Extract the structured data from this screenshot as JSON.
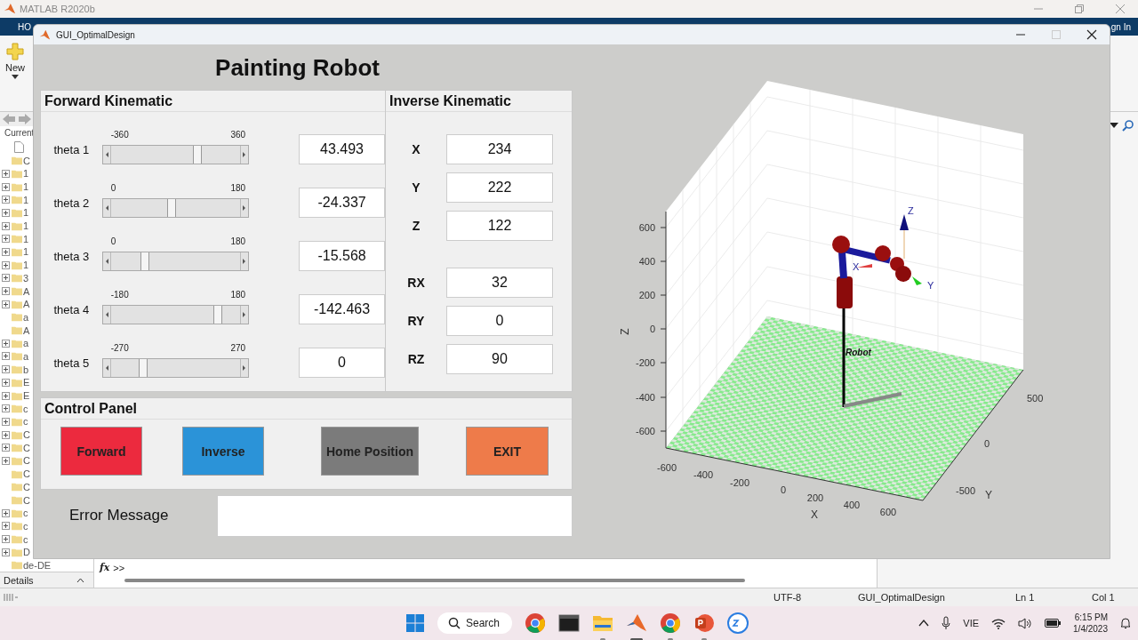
{
  "desktop_window": {
    "title": "MATLAB R2020b",
    "toolstrip_tab": "HO",
    "sign_in": "gn In",
    "new_button": "New",
    "current_folder_label": "Current",
    "folders": [
      {
        "name": "C",
        "expandable": false
      },
      {
        "name": "1",
        "expandable": true
      },
      {
        "name": "1",
        "expandable": true
      },
      {
        "name": "1",
        "expandable": true
      },
      {
        "name": "1",
        "expandable": true
      },
      {
        "name": "1",
        "expandable": true
      },
      {
        "name": "1",
        "expandable": true
      },
      {
        "name": "1",
        "expandable": true
      },
      {
        "name": "1",
        "expandable": true
      },
      {
        "name": "3",
        "expandable": true
      },
      {
        "name": "A",
        "expandable": true
      },
      {
        "name": "A",
        "expandable": true
      },
      {
        "name": "a",
        "expandable": false
      },
      {
        "name": "A",
        "expandable": false
      },
      {
        "name": "a",
        "expandable": true
      },
      {
        "name": "a",
        "expandable": true
      },
      {
        "name": "b",
        "expandable": true
      },
      {
        "name": "E",
        "expandable": true
      },
      {
        "name": "E",
        "expandable": true
      },
      {
        "name": "c",
        "expandable": true
      },
      {
        "name": "c",
        "expandable": true
      },
      {
        "name": "C",
        "expandable": true
      },
      {
        "name": "C",
        "expandable": true
      },
      {
        "name": "C",
        "expandable": true
      },
      {
        "name": "C",
        "expandable": false
      },
      {
        "name": "C",
        "expandable": false
      },
      {
        "name": "C",
        "expandable": false
      },
      {
        "name": "c",
        "expandable": true
      },
      {
        "name": "c",
        "expandable": true
      },
      {
        "name": "c",
        "expandable": true
      },
      {
        "name": "D",
        "expandable": true
      },
      {
        "name": "de-DE",
        "expandable": false
      }
    ],
    "command_fx": "fx",
    "command_prompt": ">>",
    "details_label": "Details",
    "status": {
      "encoding": "UTF-8",
      "file": "GUI_OptimalDesign",
      "line": "Ln  1",
      "column": "Col  1"
    }
  },
  "gui_window": {
    "title": "GUI_OptimalDesign",
    "heading": "Painting Robot",
    "forward_kinematic": {
      "title": "Forward Kinematic",
      "joints": [
        {
          "label": "theta 1",
          "min": "-360",
          "max": "360",
          "level": 0.66,
          "value": "43.493"
        },
        {
          "label": "theta 2",
          "min": "0",
          "max": "180",
          "level": 0.46,
          "value": "-24.337"
        },
        {
          "label": "theta 3",
          "min": "0",
          "max": "180",
          "level": 0.26,
          "value": "-15.568"
        },
        {
          "label": "theta 4",
          "min": "-180",
          "max": "180",
          "level": 0.82,
          "value": "-142.463"
        },
        {
          "label": "theta 5",
          "min": "-270",
          "max": "270",
          "level": 0.24,
          "value": "0"
        }
      ]
    },
    "inverse_kinematic": {
      "title": "Inverse Kinematic",
      "fields": [
        {
          "label": "X",
          "value": "234"
        },
        {
          "label": "Y",
          "value": "222"
        },
        {
          "label": "Z",
          "value": "122"
        },
        {
          "label": "RX",
          "value": "32"
        },
        {
          "label": "RY",
          "value": "0"
        },
        {
          "label": "RZ",
          "value": "90"
        }
      ]
    },
    "control_panel": {
      "title": "Control Panel",
      "buttons": [
        {
          "label": "Forward",
          "color": "#ec2a3e"
        },
        {
          "label": "Inverse",
          "color": "#2b93d8"
        },
        {
          "label": "Home Position",
          "color": "#7b7b7b"
        },
        {
          "label": "EXIT",
          "color": "#ee7b4a"
        }
      ]
    },
    "error_message": {
      "label": "Error Message"
    },
    "plot": {
      "robot_label": "Robot",
      "x_label": "X",
      "y_label": "Y",
      "z_label": "Z",
      "z_ticks": [
        "600",
        "400",
        "200",
        "0",
        "-200",
        "-400",
        "-600"
      ],
      "x_ticks": [
        "-600",
        "-400",
        "-200",
        "0",
        "200",
        "400",
        "600"
      ],
      "y_ticks": [
        "500",
        "0",
        "-500"
      ],
      "frame_axes": [
        "Z",
        "X",
        "Y"
      ]
    }
  },
  "taskbar": {
    "search": "Search",
    "language": "VIE",
    "time": "6:15 PM",
    "date": "1/4/2023",
    "apps": [
      {
        "kind": "chrome",
        "running": false,
        "active": false
      },
      {
        "kind": "terminal",
        "running": false,
        "active": false
      },
      {
        "kind": "folder",
        "running": true,
        "active": false
      },
      {
        "kind": "matlab",
        "running": true,
        "active": true
      },
      {
        "kind": "chrome",
        "running": true,
        "active": false
      },
      {
        "kind": "powerpoint",
        "running": true,
        "active": false
      },
      {
        "kind": "zalo",
        "running": false,
        "active": false
      }
    ]
  }
}
